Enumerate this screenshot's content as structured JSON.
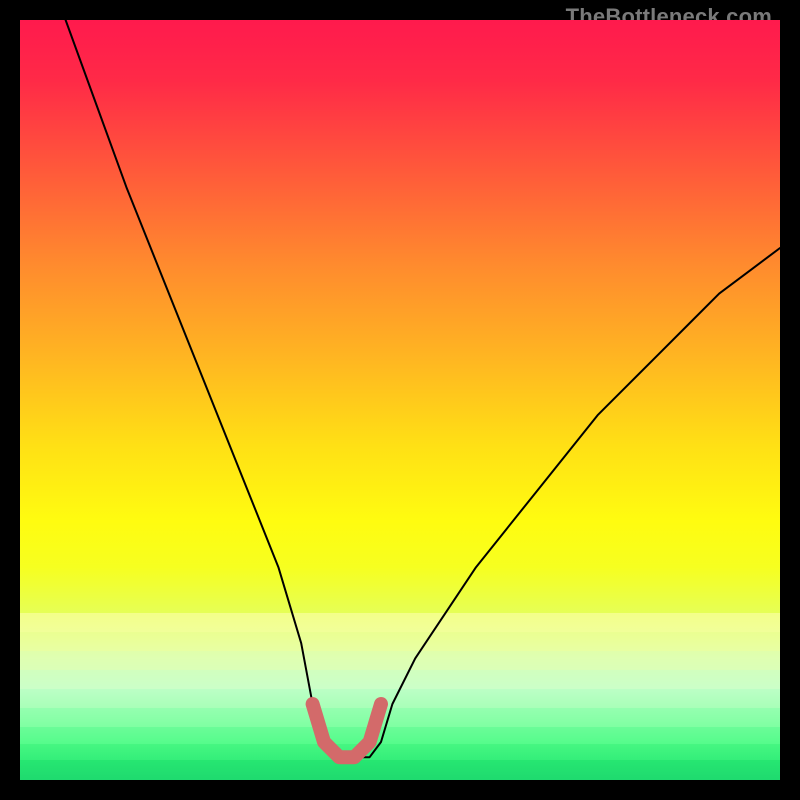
{
  "watermark": "TheBottleneck.com",
  "chart_data": {
    "type": "line",
    "title": "",
    "xlabel": "",
    "ylabel": "",
    "xlim": [
      0,
      100
    ],
    "ylim": [
      0,
      100
    ],
    "grid": false,
    "legend": false,
    "series": [
      {
        "name": "bottleneck-curve",
        "x": [
          6,
          10,
          14,
          18,
          22,
          26,
          30,
          34,
          37,
          38.5,
          40,
          42,
          44,
          46,
          47.5,
          49,
          52,
          56,
          60,
          64,
          68,
          72,
          76,
          80,
          84,
          88,
          92,
          96,
          100
        ],
        "values": [
          100,
          89,
          78,
          68,
          58,
          48,
          38,
          28,
          18,
          10,
          5,
          3,
          3,
          3,
          5,
          10,
          16,
          22,
          28,
          33,
          38,
          43,
          48,
          52,
          56,
          60,
          64,
          67,
          70
        ]
      },
      {
        "name": "optimal-range-marker",
        "x": [
          38.5,
          40,
          42,
          44,
          46,
          47.5
        ],
        "values": [
          10,
          5,
          3,
          3,
          5,
          10
        ]
      }
    ],
    "gradient_stops": [
      {
        "pos": 0,
        "color": "#ff1a4d"
      },
      {
        "pos": 20,
        "color": "#ff5a3a"
      },
      {
        "pos": 44,
        "color": "#ffb422"
      },
      {
        "pos": 66,
        "color": "#fffc10"
      },
      {
        "pos": 84,
        "color": "#d8ffaa"
      },
      {
        "pos": 95,
        "color": "#4cff7a"
      },
      {
        "pos": 100,
        "color": "#14d064"
      }
    ],
    "accent_band_color": "#d36a6a",
    "curve_color": "#000000"
  }
}
